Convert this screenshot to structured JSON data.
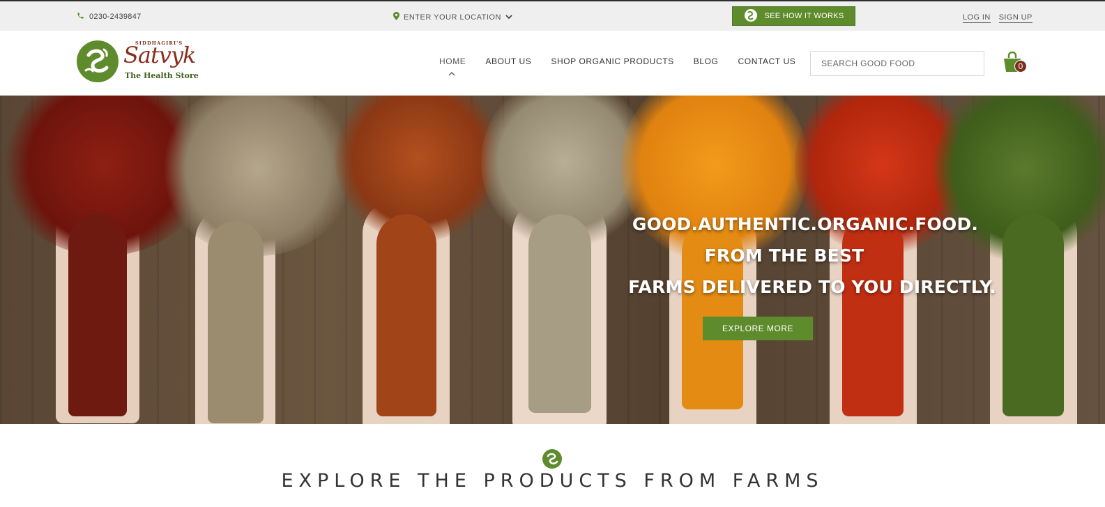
{
  "topbar": {
    "phone": "0230-2439847",
    "location_label": "ENTER YOUR LOCATION",
    "cta_label": "SEE HOW IT WORKS",
    "login_label": "LOG IN",
    "signup_label": "SIGN UP"
  },
  "header": {
    "logo": {
      "prefix": "SIDDHAGIRI'S",
      "name": "Satvyk",
      "tagline": "The Health Store"
    },
    "nav": [
      {
        "label": "HOME",
        "active": true
      },
      {
        "label": "ABOUT US",
        "active": false
      },
      {
        "label": "SHOP ORGANIC PRODUCTS",
        "active": false
      },
      {
        "label": "BLOG",
        "active": false
      },
      {
        "label": "CONTACT US",
        "active": false
      }
    ],
    "search_placeholder": "SEARCH GOOD FOOD",
    "cart_count": "0"
  },
  "hero": {
    "line1": "GOOD.AUTHENTIC.ORGANIC.FOOD.",
    "line2": "FROM THE BEST",
    "line3": "FARMS DELIVERED TO YOU DIRECTLY.",
    "button_label": "EXPLORE MORE"
  },
  "explore": {
    "title": "EXPLORE THE PRODUCTS FROM FARMS"
  },
  "colors": {
    "brand_green": "#5e8b2b",
    "brand_brown": "#8a2e1c",
    "topbar_bg": "#efefef"
  },
  "icons": {
    "phone": "phone-icon",
    "location": "map-pin-icon",
    "cart": "shopping-bag-icon",
    "brand": "satvyk-leaf-icon"
  }
}
